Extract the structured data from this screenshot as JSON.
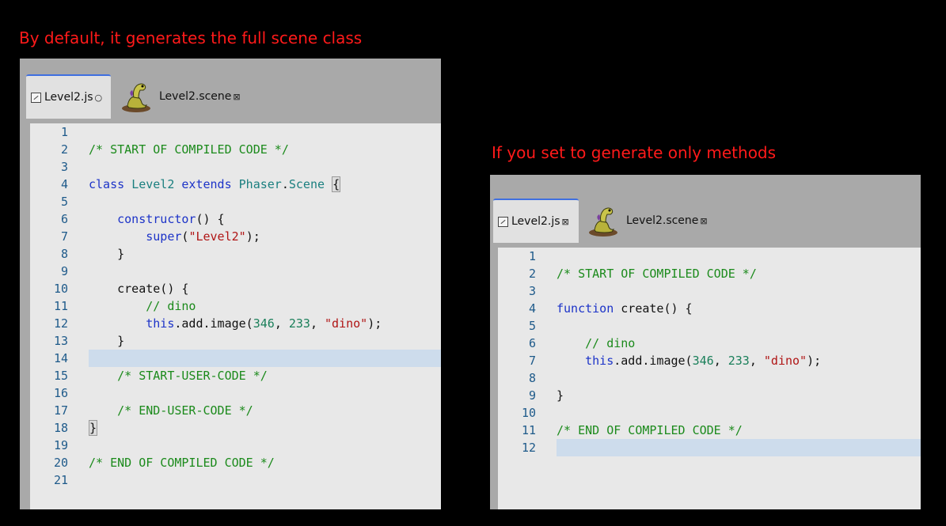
{
  "captions": {
    "left": "By default, it generates the full scene class",
    "right": "If you set to generate only methods"
  },
  "left_editor": {
    "tabs": [
      {
        "label": "Level2.js",
        "icon": "file-code-icon",
        "close": "○",
        "active": true
      },
      {
        "label": "Level2.scene",
        "icon": "dino-sprite-icon",
        "close": "⊠",
        "active": false
      }
    ],
    "highlighted_line": 14,
    "lines": [
      {
        "n": "1",
        "tokens": []
      },
      {
        "n": "2",
        "tokens": [
          {
            "t": "/* START OF COMPILED CODE */",
            "c": "cm"
          }
        ]
      },
      {
        "n": "3",
        "tokens": []
      },
      {
        "n": "4",
        "tokens": [
          {
            "t": "class",
            "c": "kw"
          },
          {
            "t": " "
          },
          {
            "t": "Level2",
            "c": "ty"
          },
          {
            "t": " "
          },
          {
            "t": "extends",
            "c": "kw"
          },
          {
            "t": " "
          },
          {
            "t": "Phaser",
            "c": "ty"
          },
          {
            "t": "."
          },
          {
            "t": "Scene",
            "c": "ty"
          },
          {
            "t": " "
          },
          {
            "t": "{",
            "c": "br"
          }
        ]
      },
      {
        "n": "5",
        "tokens": []
      },
      {
        "n": "6",
        "tokens": [
          {
            "t": "    "
          },
          {
            "t": "constructor",
            "c": "kw"
          },
          {
            "t": "() {"
          }
        ]
      },
      {
        "n": "7",
        "tokens": [
          {
            "t": "        "
          },
          {
            "t": "super",
            "c": "kw"
          },
          {
            "t": "("
          },
          {
            "t": "\"Level2\"",
            "c": "st"
          },
          {
            "t": ");"
          }
        ]
      },
      {
        "n": "8",
        "tokens": [
          {
            "t": "    }"
          }
        ]
      },
      {
        "n": "9",
        "tokens": []
      },
      {
        "n": "10",
        "tokens": [
          {
            "t": "    create() {"
          }
        ]
      },
      {
        "n": "11",
        "tokens": [
          {
            "t": "        "
          },
          {
            "t": "// dino",
            "c": "cm"
          }
        ]
      },
      {
        "n": "12",
        "tokens": [
          {
            "t": "        "
          },
          {
            "t": "this",
            "c": "kw"
          },
          {
            "t": ".add.image("
          },
          {
            "t": "346",
            "c": "nm"
          },
          {
            "t": ", "
          },
          {
            "t": "233",
            "c": "nm"
          },
          {
            "t": ", "
          },
          {
            "t": "\"dino\"",
            "c": "st"
          },
          {
            "t": ");"
          }
        ]
      },
      {
        "n": "13",
        "tokens": [
          {
            "t": "    }"
          }
        ]
      },
      {
        "n": "14",
        "tokens": []
      },
      {
        "n": "15",
        "tokens": [
          {
            "t": "    "
          },
          {
            "t": "/* START-USER-CODE */",
            "c": "cm"
          }
        ]
      },
      {
        "n": "16",
        "tokens": []
      },
      {
        "n": "17",
        "tokens": [
          {
            "t": "    "
          },
          {
            "t": "/* END-USER-CODE */",
            "c": "cm"
          }
        ]
      },
      {
        "n": "18",
        "tokens": [
          {
            "t": "}",
            "c": "br"
          }
        ]
      },
      {
        "n": "19",
        "tokens": []
      },
      {
        "n": "20",
        "tokens": [
          {
            "t": "/* END OF COMPILED CODE */",
            "c": "cm"
          }
        ]
      },
      {
        "n": "21",
        "tokens": []
      }
    ]
  },
  "right_editor": {
    "tabs": [
      {
        "label": "Level2.js",
        "icon": "file-code-icon",
        "close": "⊠",
        "active": true
      },
      {
        "label": "Level2.scene",
        "icon": "dino-sprite-icon",
        "close": "⊠",
        "active": false
      }
    ],
    "highlighted_line": 12,
    "lines": [
      {
        "n": "1",
        "tokens": []
      },
      {
        "n": "2",
        "tokens": [
          {
            "t": "/* START OF COMPILED CODE */",
            "c": "cm"
          }
        ]
      },
      {
        "n": "3",
        "tokens": []
      },
      {
        "n": "4",
        "tokens": [
          {
            "t": "function",
            "c": "kw"
          },
          {
            "t": " create() {"
          }
        ]
      },
      {
        "n": "5",
        "tokens": []
      },
      {
        "n": "6",
        "tokens": [
          {
            "t": "    "
          },
          {
            "t": "// dino",
            "c": "cm"
          }
        ]
      },
      {
        "n": "7",
        "tokens": [
          {
            "t": "    "
          },
          {
            "t": "this",
            "c": "kw"
          },
          {
            "t": ".add.image("
          },
          {
            "t": "346",
            "c": "nm"
          },
          {
            "t": ", "
          },
          {
            "t": "233",
            "c": "nm"
          },
          {
            "t": ", "
          },
          {
            "t": "\"dino\"",
            "c": "st"
          },
          {
            "t": ");"
          }
        ]
      },
      {
        "n": "8",
        "tokens": []
      },
      {
        "n": "9",
        "tokens": [
          {
            "t": "}"
          }
        ]
      },
      {
        "n": "10",
        "tokens": []
      },
      {
        "n": "11",
        "tokens": [
          {
            "t": "/* END OF COMPILED CODE */",
            "c": "cm"
          }
        ]
      },
      {
        "n": "12",
        "tokens": []
      }
    ]
  }
}
